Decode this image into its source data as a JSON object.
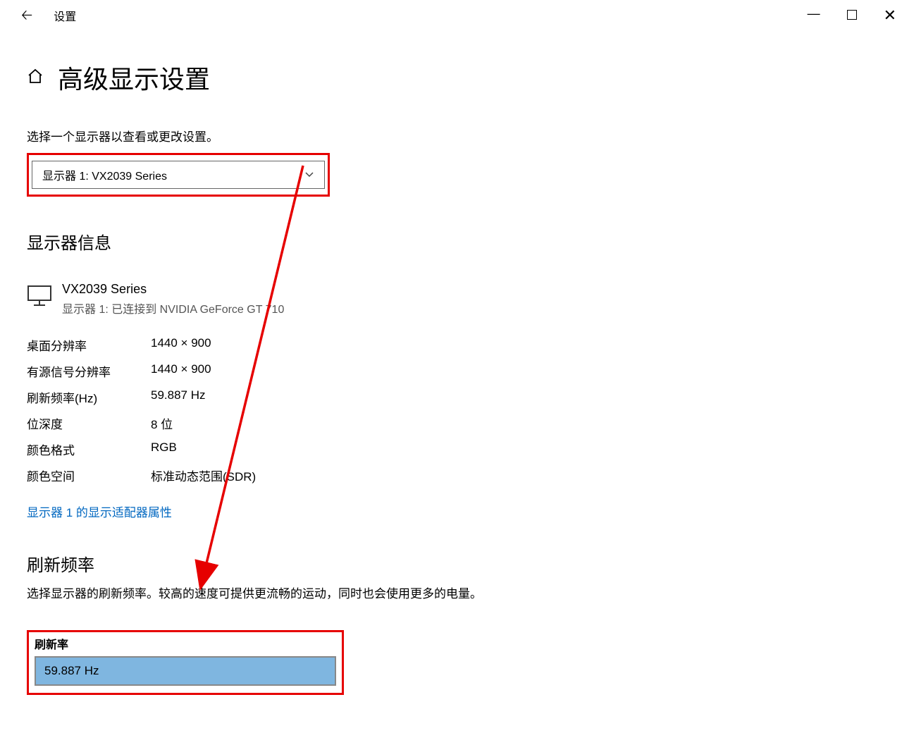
{
  "titlebar": {
    "title": "设置"
  },
  "page": {
    "title": "高级显示设置"
  },
  "select_monitor": {
    "desc": "选择一个显示器以查看或更改设置。",
    "dropdown_label": "显示器 1: VX2039 Series"
  },
  "monitor_info": {
    "section_title": "显示器信息",
    "monitor_name": "VX2039 Series",
    "monitor_sub": "显示器 1: 已连接到 NVIDIA GeForce GT 710",
    "rows": [
      {
        "label": "桌面分辨率",
        "value": "1440 × 900"
      },
      {
        "label": "有源信号分辨率",
        "value": "1440 × 900"
      },
      {
        "label": "刷新频率(Hz)",
        "value": "59.887 Hz"
      },
      {
        "label": "位深度",
        "value": "8 位"
      },
      {
        "label": "颜色格式",
        "value": "RGB"
      },
      {
        "label": "颜色空间",
        "value": "标准动态范围(SDR)"
      }
    ],
    "adapter_link": "显示器 1 的显示适配器属性"
  },
  "refresh": {
    "section_title": "刷新频率",
    "desc": "选择显示器的刷新频率。较高的速度可提供更流畅的运动，同时也会使用更多的电量。",
    "label": "刷新率",
    "value": "59.887 Hz"
  }
}
